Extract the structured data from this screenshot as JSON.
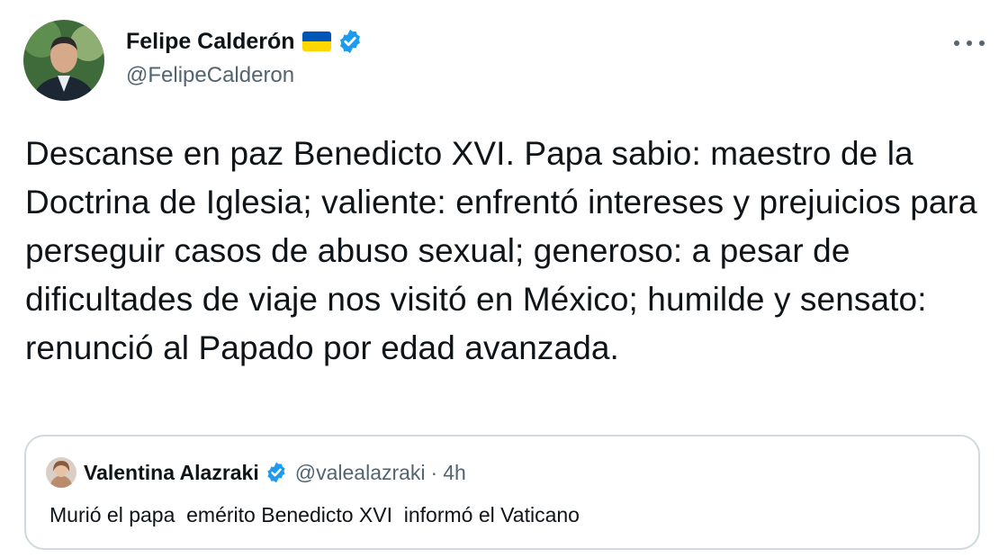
{
  "tweet": {
    "author": {
      "name": "Felipe Calderón",
      "handle": "@FelipeCalderon",
      "flag": "ukraine-flag",
      "verified": true
    },
    "text": "Descanse en paz Benedicto XVI. Papa sabio: maestro de la Doctrina de Iglesia; valiente: enfrentó intereses y prejuicios para perseguir casos de abuso sexual; generoso: a pesar de dificultades de viaje nos visitó en México; humilde y sensato: renunció al Papado por edad avanzada.",
    "more_icon": "more-horizontal-icon"
  },
  "quote": {
    "author": {
      "name": "Valentina Alazraki",
      "handle": "@valealazraki",
      "verified": true
    },
    "separator": "·",
    "time": "4h",
    "text": "Murió el papa  emérito Benedicto XVI  informó el Vaticano"
  },
  "colors": {
    "verified_blue": "#1d9bf0",
    "text_primary": "#0f1419",
    "text_secondary": "#536471",
    "border": "#cfd9de",
    "flag_blue": "#0057b7",
    "flag_yellow": "#ffd700"
  }
}
